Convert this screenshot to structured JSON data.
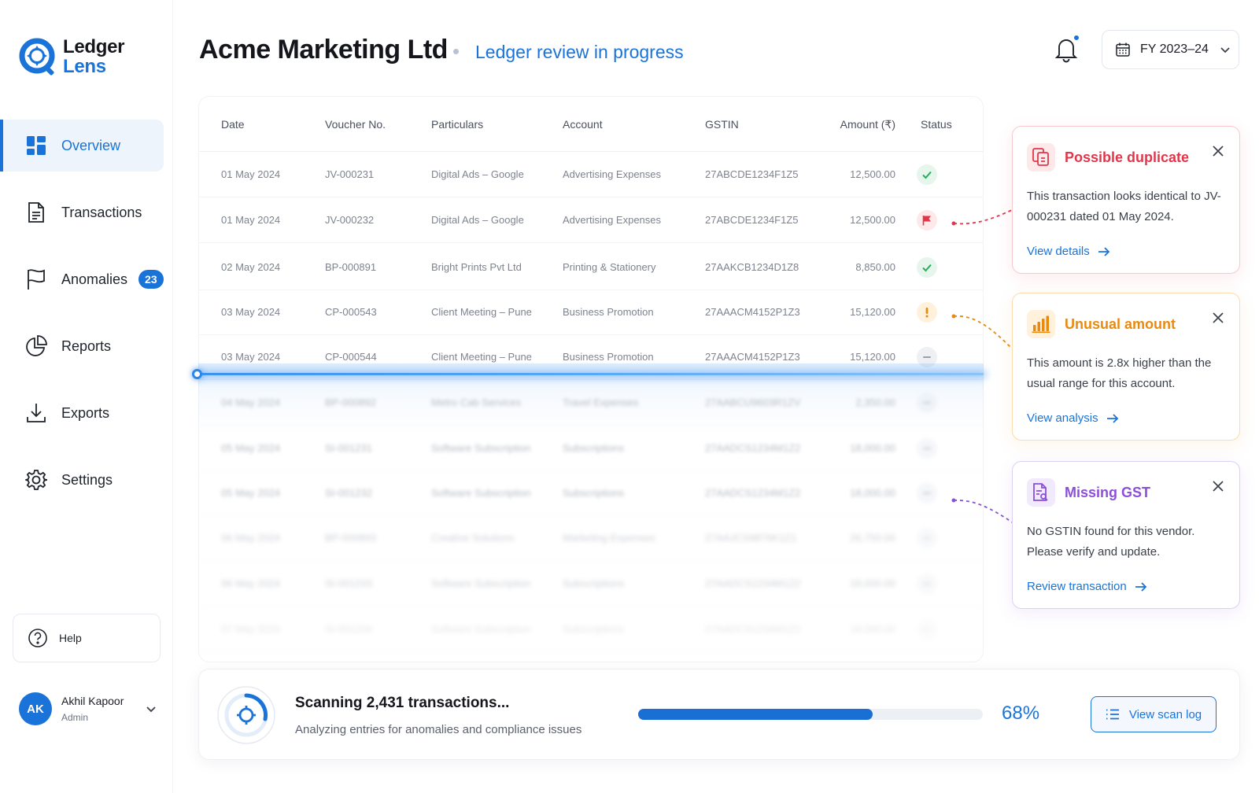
{
  "brand": {
    "line1": "Ledger",
    "line2": "Lens"
  },
  "colors": {
    "primary": "#1a73d9",
    "danger": "#e2364b",
    "warning": "#e98a10",
    "purple": "#8b4fd8",
    "success": "#2eaa5c"
  },
  "sidebar": {
    "items": [
      {
        "label": "Overview",
        "icon": "overview-grid-icon",
        "active": true
      },
      {
        "label": "Transactions",
        "icon": "document-icon"
      },
      {
        "label": "Anomalies",
        "icon": "flag-icon",
        "badge": "23"
      },
      {
        "label": "Reports",
        "icon": "pie-chart-icon"
      },
      {
        "label": "Exports",
        "icon": "download-icon"
      },
      {
        "label": "Settings",
        "icon": "gear-icon"
      }
    ],
    "help_label": "Help"
  },
  "user": {
    "initials": "AK",
    "name": "Akhil Kapoor",
    "role": "Admin"
  },
  "header": {
    "title": "Acme Marketing Ltd",
    "subtitle": "Ledger review in progress",
    "fy_label": "FY 2023–24"
  },
  "table": {
    "columns": [
      "Date",
      "Voucher No.",
      "Particulars",
      "Account",
      "GSTIN",
      "Amount (₹)",
      "Status"
    ],
    "rows": [
      {
        "date": "01 May 2024",
        "voucher": "JV-000231",
        "particulars": "Digital Ads – Google",
        "account": "Advertising Expenses",
        "gstin": "27ABCDE1234F1Z5",
        "amount": "12,500.00",
        "status": "ok"
      },
      {
        "date": "01 May 2024",
        "voucher": "JV-000232",
        "particulars": "Digital Ads – Google",
        "account": "Advertising Expenses",
        "gstin": "27ABCDE1234F1Z5",
        "amount": "12,500.00",
        "status": "flag"
      },
      {
        "date": "02 May 2024",
        "voucher": "BP-000891",
        "particulars": "Bright Prints Pvt Ltd",
        "account": "Printing & Stationery",
        "gstin": "27AAKCB1234D1Z8",
        "amount": "8,850.00",
        "status": "ok"
      },
      {
        "date": "03 May 2024",
        "voucher": "CP-000543",
        "particulars": "Client Meeting – Pune",
        "account": "Business Promotion",
        "gstin": "27AAACM4152P1Z3",
        "amount": "15,120.00",
        "status": "warn"
      },
      {
        "date": "03 May 2024",
        "voucher": "CP-000544",
        "particulars": "Client Meeting – Pune",
        "account": "Business Promotion",
        "gstin": "27AAACM4152P1Z3",
        "amount": "15,120.00",
        "status": "pending"
      },
      {
        "date": "04 May 2024",
        "voucher": "BP-000892",
        "particulars": "Metro Cab Services",
        "account": "Travel Expenses",
        "gstin": "27AABCU9603R1ZV",
        "amount": "2,350.00",
        "status": "pending"
      },
      {
        "date": "05 May 2024",
        "voucher": "SI-001231",
        "particulars": "Software Subscription",
        "account": "Subscriptions",
        "gstin": "27AADCS1234M1Z2",
        "amount": "18,000.00",
        "status": "pending"
      },
      {
        "date": "05 May 2024",
        "voucher": "SI-001232",
        "particulars": "Software Subscription",
        "account": "Subscriptions",
        "gstin": "27AADCS1234M1Z2",
        "amount": "18,000.00",
        "status": "pending"
      },
      {
        "date": "06 May 2024",
        "voucher": "BP-000893",
        "particulars": "Creative Solutions",
        "account": "Marketing Expenses",
        "gstin": "27AAJCS9876K1Z1",
        "amount": "26,750.00",
        "status": "pending"
      },
      {
        "date": "06 May 2024",
        "voucher": "SI-001233",
        "particulars": "Software Subscription",
        "account": "Subscriptions",
        "gstin": "27AADCS1234M1Z2",
        "amount": "18,000.00",
        "status": "pending"
      },
      {
        "date": "07 May 2024",
        "voucher": "SI-001234",
        "particulars": "Software Subscription",
        "account": "Subscriptions",
        "gstin": "27AADCS1234M1Z2",
        "amount": "18,000.00",
        "status": "pending"
      }
    ]
  },
  "alerts": [
    {
      "title": "Possible duplicate",
      "body": "This transaction looks identical to JV-000231 dated 01 May 2024.",
      "link": "View details",
      "tone": "red",
      "icon": "duplicate-icon"
    },
    {
      "title": "Unusual amount",
      "body": "This amount is 2.8x higher than the usual range for this account.",
      "link": "View analysis",
      "tone": "orange",
      "icon": "bar-chart-icon"
    },
    {
      "title": "Missing GST",
      "body": "No GSTIN found for this vendor. Please verify and update.",
      "link": "Review transaction",
      "tone": "purple",
      "icon": "document-search-icon"
    }
  ],
  "scan": {
    "title": "Scanning 2,431 transactions...",
    "subtitle": "Analyzing entries for anomalies and compliance issues",
    "progress": 68,
    "progress_label": "68%",
    "button_label": "View scan log"
  }
}
